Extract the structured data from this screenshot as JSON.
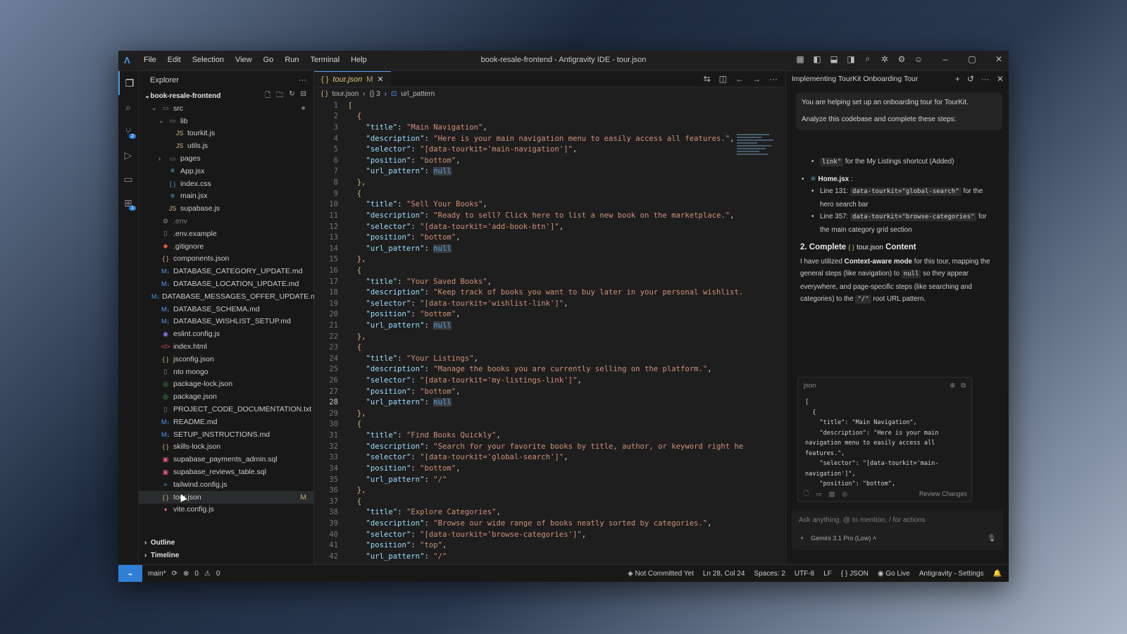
{
  "window_title": "book-resale-frontend - Antigravity IDE - tour.json",
  "menu": [
    "File",
    "Edit",
    "Selection",
    "View",
    "Go",
    "Run",
    "Terminal",
    "Help"
  ],
  "explorer": {
    "title": "Explorer",
    "root": "book-resale-frontend",
    "items": [
      {
        "label": "src",
        "indent": 1,
        "chevron": "v",
        "icon": "folder-icon"
      },
      {
        "label": "lib",
        "indent": 2,
        "chevron": "v",
        "icon": "folder-icon"
      },
      {
        "label": "tourkit.js",
        "indent": 3,
        "icon": "js-icon"
      },
      {
        "label": "utils.js",
        "indent": 3,
        "icon": "js-icon"
      },
      {
        "label": "pages",
        "indent": 2,
        "chevron": ">",
        "icon": "folder-icon"
      },
      {
        "label": "App.jsx",
        "indent": 2,
        "icon": "react-icon"
      },
      {
        "label": "index.css",
        "indent": 2,
        "icon": "css-icon"
      },
      {
        "label": "main.jsx",
        "indent": 2,
        "icon": "react-icon"
      },
      {
        "label": "supabase.js",
        "indent": 2,
        "icon": "js-icon"
      },
      {
        "label": ".env",
        "indent": 1,
        "icon": "gear-icon",
        "dim": true
      },
      {
        "label": ".env.example",
        "indent": 1,
        "icon": "file-icon"
      },
      {
        "label": ".gitignore",
        "indent": 1,
        "icon": "git-icon"
      },
      {
        "label": "components.json",
        "indent": 1,
        "icon": "json-icon"
      },
      {
        "label": "DATABASE_CATEGORY_UPDATE.md",
        "indent": 1,
        "icon": "markdown-icon"
      },
      {
        "label": "DATABASE_LOCATION_UPDATE.md",
        "indent": 1,
        "icon": "markdown-icon"
      },
      {
        "label": "DATABASE_MESSAGES_OFFER_UPDATE.md",
        "indent": 1,
        "icon": "markdown-icon"
      },
      {
        "label": "DATABASE_SCHEMA.md",
        "indent": 1,
        "icon": "markdown-icon"
      },
      {
        "label": "DATABASE_WISHLIST_SETUP.md",
        "indent": 1,
        "icon": "markdown-icon"
      },
      {
        "label": "eslint.config.js",
        "indent": 1,
        "icon": "eslint-icon"
      },
      {
        "label": "index.html",
        "indent": 1,
        "icon": "html-icon"
      },
      {
        "label": "jsconfig.json",
        "indent": 1,
        "icon": "json-icon"
      },
      {
        "label": "nto mongo",
        "indent": 1,
        "icon": "file-icon"
      },
      {
        "label": "package-lock.json",
        "indent": 1,
        "icon": "npm-icon"
      },
      {
        "label": "package.json",
        "indent": 1,
        "icon": "npm-icon"
      },
      {
        "label": "PROJECT_CODE_DOCUMENTATION.txt",
        "indent": 1,
        "icon": "file-icon"
      },
      {
        "label": "README.md",
        "indent": 1,
        "icon": "markdown-icon"
      },
      {
        "label": "SETUP_INSTRUCTIONS.md",
        "indent": 1,
        "icon": "markdown-icon"
      },
      {
        "label": "skills-lock.json",
        "indent": 1,
        "icon": "json-icon"
      },
      {
        "label": "supabase_payments_admin.sql",
        "indent": 1,
        "icon": "database-icon"
      },
      {
        "label": "supabase_reviews_table.sql",
        "indent": 1,
        "icon": "database-icon"
      },
      {
        "label": "tailwind.config.js",
        "indent": 1,
        "icon": "tailwind-icon"
      },
      {
        "label": "tour.json",
        "indent": 1,
        "icon": "json-icon",
        "selected": true,
        "badge": "M"
      },
      {
        "label": "vite.config.js",
        "indent": 1,
        "icon": "vite-icon"
      }
    ],
    "sections": [
      "Outline",
      "Timeline"
    ]
  },
  "editor": {
    "tab_label": "tour.json",
    "tab_badge": "M",
    "breadcrumb": [
      "tour.json",
      "{} 3",
      "url_pattern"
    ],
    "current_line": 28,
    "lines": [
      {
        "n": 1,
        "t": "["
      },
      {
        "n": 2,
        "t": "  {"
      },
      {
        "n": 3,
        "k": "title",
        "v": "\"Main Navigation\"",
        "c": ","
      },
      {
        "n": 4,
        "k": "description",
        "v": "\"Here is your main navigation menu to easily access all features.\"",
        "c": ","
      },
      {
        "n": 5,
        "k": "selector",
        "v": "\"[data-tourkit='main-navigation']\"",
        "c": ","
      },
      {
        "n": 6,
        "k": "position",
        "v": "\"bottom\"",
        "c": ","
      },
      {
        "n": 7,
        "k": "url_pattern",
        "v": "null",
        "c": ""
      },
      {
        "n": 8,
        "t": "  },"
      },
      {
        "n": 9,
        "t": "  {"
      },
      {
        "n": 10,
        "k": "title",
        "v": "\"Sell Your Books\"",
        "c": ","
      },
      {
        "n": 11,
        "k": "description",
        "v": "\"Ready to sell? Click here to list a new book on the marketplace.\"",
        "c": ","
      },
      {
        "n": 12,
        "k": "selector",
        "v": "\"[data-tourkit='add-book-btn']\"",
        "c": ","
      },
      {
        "n": 13,
        "k": "position",
        "v": "\"bottom\"",
        "c": ","
      },
      {
        "n": 14,
        "k": "url_pattern",
        "v": "null",
        "c": ""
      },
      {
        "n": 15,
        "t": "  },"
      },
      {
        "n": 16,
        "t": "  {"
      },
      {
        "n": 17,
        "k": "title",
        "v": "\"Your Saved Books\"",
        "c": ","
      },
      {
        "n": 18,
        "k": "description",
        "v": "\"Keep track of books you want to buy later in your personal wishlist.",
        "c": ""
      },
      {
        "n": 19,
        "k": "selector",
        "v": "\"[data-tourkit='wishlist-link']\"",
        "c": ","
      },
      {
        "n": 20,
        "k": "position",
        "v": "\"bottom\"",
        "c": ","
      },
      {
        "n": 21,
        "k": "url_pattern",
        "v": "null",
        "c": ""
      },
      {
        "n": 22,
        "t": "  },"
      },
      {
        "n": 23,
        "t": "  {"
      },
      {
        "n": 24,
        "k": "title",
        "v": "\"Your Listings\"",
        "c": ","
      },
      {
        "n": 25,
        "k": "description",
        "v": "\"Manage the books you are currently selling on the platform.\"",
        "c": ","
      },
      {
        "n": 26,
        "k": "selector",
        "v": "\"[data-tourkit='my-listings-link']\"",
        "c": ","
      },
      {
        "n": 27,
        "k": "position",
        "v": "\"bottom\"",
        "c": ","
      },
      {
        "n": 28,
        "k": "url_pattern",
        "v": "null",
        "c": ""
      },
      {
        "n": 29,
        "t": "  },"
      },
      {
        "n": 30,
        "t": "  {"
      },
      {
        "n": 31,
        "k": "title",
        "v": "\"Find Books Quickly\"",
        "c": ","
      },
      {
        "n": 32,
        "k": "description",
        "v": "\"Search for your favorite books by title, author, or keyword right he",
        "c": ""
      },
      {
        "n": 33,
        "k": "selector",
        "v": "\"[data-tourkit='global-search']\"",
        "c": ","
      },
      {
        "n": 34,
        "k": "position",
        "v": "\"bottom\"",
        "c": ","
      },
      {
        "n": 35,
        "k": "url_pattern",
        "v": "\"/\"",
        "c": ""
      },
      {
        "n": 36,
        "t": "  },"
      },
      {
        "n": 37,
        "t": "  {"
      },
      {
        "n": 38,
        "k": "title",
        "v": "\"Explore Categories\"",
        "c": ","
      },
      {
        "n": 39,
        "k": "description",
        "v": "\"Browse our wide range of books neatly sorted by categories.\"",
        "c": ","
      },
      {
        "n": 40,
        "k": "selector",
        "v": "\"[data-tourkit='browse-categories']\"",
        "c": ","
      },
      {
        "n": 41,
        "k": "position",
        "v": "\"top\"",
        "c": ","
      },
      {
        "n": 42,
        "k": "url_pattern",
        "v": "\"/\"",
        "c": ""
      }
    ]
  },
  "chat": {
    "title": "Implementing TourKit Onboarding Tour",
    "prompt_1": "You are helping set up an onboarding tour for TourKit.",
    "prompt_2": "Analyze this codebase and complete these steps:",
    "r_link_code": "link\"",
    "r_link_text": "for the My Listings shortcut (Added)",
    "r_home": "Home.jsx",
    "r_home_colon": ":",
    "r_line131_label": "Line 131:",
    "r_line131_code": "data-tourkit=\"global-search\"",
    "r_line131_text": "for the hero search bar",
    "r_line357_label": "Line 357:",
    "r_line357_code": "data-tourkit=\"browse-categories\"",
    "r_line357_text": "for the main category grid section",
    "h2_prefix": "2. Complete",
    "h2_file": "tour.json",
    "h2_suffix": "Content",
    "p1_a": "I have utilized",
    "p1_b": "Context-aware mode",
    "p1_c": "for this tour, mapping the general steps (like navigation) to",
    "p1_null": "null",
    "p1_d": "so they appear everywhere, and page-specific steps (like searching and categories) to the",
    "p1_root": "\"/\"",
    "p1_e": "root URL pattern.",
    "code_lang": "json",
    "code_preview": "[\n  {\n    \"title\": \"Main Navigation\",\n    \"description\": \"Here is your main navigation menu to easily access all features.\",\n    \"selector\": \"[data-tourkit='main-navigation']\",\n    \"position\": \"bottom\",",
    "review_label": "Review Changes",
    "input_placeholder": "Ask anything, @ to mention, / for actions",
    "model_label": "Gemini 3.1 Pro (Low)"
  },
  "status": {
    "branch": "main*",
    "errors": "0",
    "warnings": "0",
    "commit": "Not Committed Yet",
    "position": "Ln 28, Col 24",
    "spaces": "Spaces: 2",
    "encoding": "UTF-8",
    "eol": "LF",
    "language": "JSON",
    "golive": "Go Live",
    "settings": "Antigravity - Settings"
  }
}
